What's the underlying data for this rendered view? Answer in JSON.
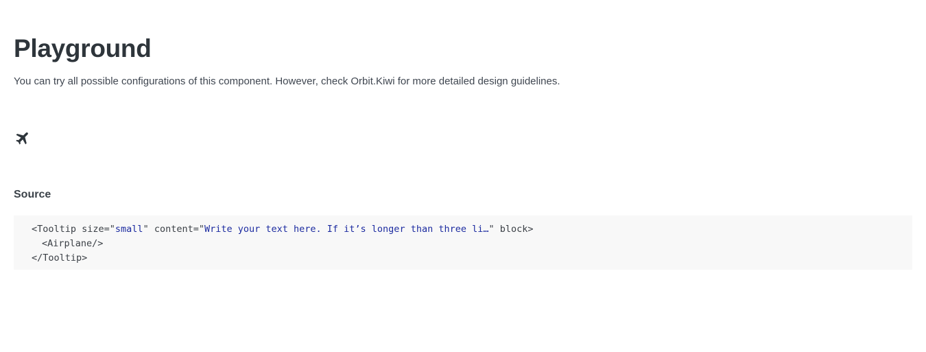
{
  "page": {
    "title": "Playground",
    "description": "You can try all possible configurations of this component. However, check Orbit.Kiwi for more detailed design guidelines."
  },
  "preview": {
    "icon": "airplane-icon"
  },
  "source": {
    "heading": "Source",
    "line1": {
      "open": "<Tooltip size=\"",
      "size_value": "small",
      "mid": "\" content=\"",
      "content_value": "Write your text here. If it’s longer than three li…",
      "close": "\" block>"
    },
    "line2": "<Airplane/>",
    "line3": "</Tooltip>"
  },
  "colors": {
    "title": "#2e353b",
    "code_background": "#f8f8f8",
    "code_string": "#1c2ba0"
  }
}
